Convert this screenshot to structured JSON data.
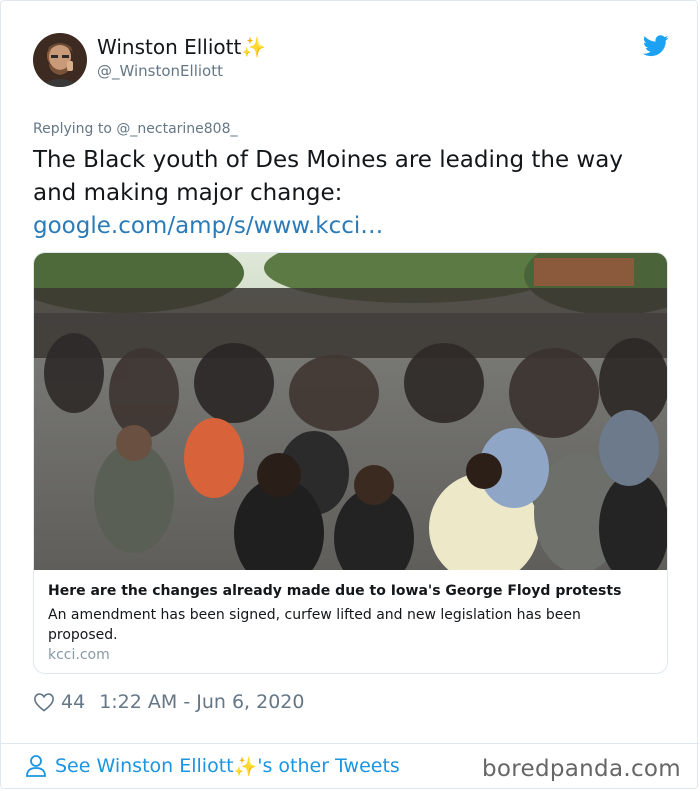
{
  "author": {
    "display_name": "Winston Elliott",
    "emoji": "✨",
    "handle": "@_WinstonElliott"
  },
  "tweet": {
    "replying_prefix": "Replying to",
    "replying_to": "@_nectarine808_",
    "text": "The Black youth of Des Moines are leading the way and making major change:",
    "link": "google.com/amp/s/www.kcci…"
  },
  "link_card": {
    "title": "Here are the changes already made due to Iowa's George Floyd protests",
    "description": "An amendment has been signed, curfew lifted and new legislation has been proposed.",
    "domain": "kcci.com"
  },
  "meta": {
    "likes": "44",
    "timestamp": "1:22 AM - Jun 6, 2020"
  },
  "footer": {
    "prefix": "See Winston Elliott",
    "emoji": "✨",
    "suffix": "'s other Tweets"
  },
  "watermark": "boredpanda.com",
  "icons": {
    "brand": "twitter-bird-icon",
    "like": "heart-icon",
    "profile": "person-icon"
  },
  "colors": {
    "link": "#2b7bb9",
    "footer_link": "#1b95e0",
    "muted": "#657786",
    "bird": "#1da1f2"
  }
}
